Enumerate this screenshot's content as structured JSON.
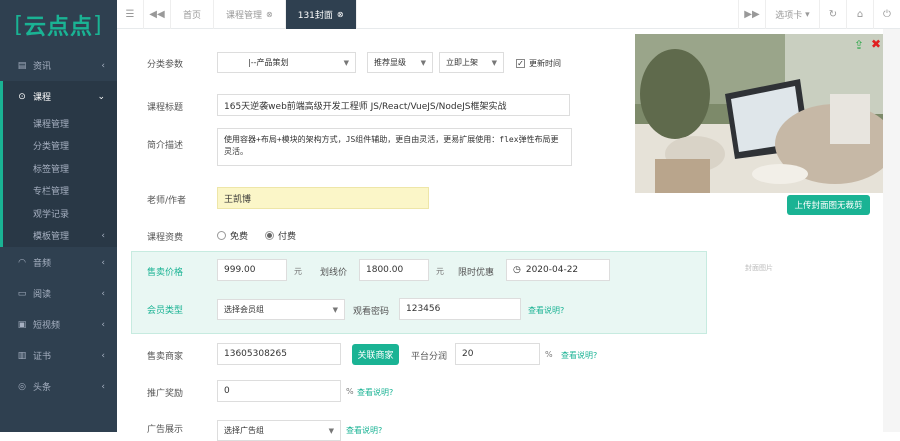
{
  "sidebar": {
    "logo": "云点点",
    "items": [
      {
        "label": "资讯",
        "icon": "news-icon"
      },
      {
        "label": "课程",
        "icon": "course-icon",
        "active": true
      },
      {
        "label": "音频",
        "icon": "headphones-icon"
      },
      {
        "label": "阅读",
        "icon": "book-icon"
      },
      {
        "label": "短视频",
        "icon": "video-icon"
      },
      {
        "label": "证书",
        "icon": "certificate-icon"
      },
      {
        "label": "头条",
        "icon": "compass-icon"
      }
    ],
    "course_sub": [
      "课程管理",
      "分类管理",
      "标签管理",
      "专栏管理",
      "观学记录",
      "模板管理"
    ]
  },
  "topbar": {
    "tabs": [
      {
        "label": "首页"
      },
      {
        "label": "课程管理"
      },
      {
        "label": "131封面",
        "active": true
      }
    ],
    "options_label": "选项卡"
  },
  "form": {
    "category_label": "分类参数",
    "category_value": "|--产品策划",
    "recommend_value": "推荐显级",
    "publish_value": "立即上架",
    "update_time_label": "更新时间",
    "title_label": "课程标题",
    "title_value": "165天逆袭web前端高级开发工程师 JS/React/VueJS/NodeJS框架实战",
    "desc_label": "简介描述",
    "desc_value": "使用容器+布局+模块的架构方式，JS组件辅助，更自由灵活，更易扩展使用：flex弹性布局更灵活。",
    "teacher_label": "老师/作者",
    "teacher_value": "王凯博",
    "fee_label": "课程资费",
    "fee_free": "免费",
    "fee_paid": "付费",
    "price_label": "售卖价格",
    "price_value": "999.00",
    "yuan1": "元",
    "line_price_label": "划线价",
    "line_price_value": "1800.00",
    "yuan2": "元",
    "limit_label": "限时优惠",
    "limit_date": "2020-04-22",
    "member_label": "会员类型",
    "member_value": "选择会员组",
    "watch_pwd_label": "观看密码",
    "watch_pwd_value": "123456",
    "see_desc1": "查看说明?",
    "merchant_label": "售卖商家",
    "merchant_value": "13605308265",
    "link_merchant_btn": "关联商家",
    "platform_label": "平台分润",
    "platform_value": "20",
    "pct1": "%",
    "see_desc2": "查看说明?",
    "promo_label": "推广奖励",
    "promo_value": "0",
    "pct2": "%",
    "see_desc3": "查看说明?",
    "ad_label": "广告展示",
    "ad_value": "选择广告组",
    "see_desc4": "查看说明?"
  },
  "cover": {
    "upload_btn": "上传封面图无裁剪",
    "label": "封面图片"
  },
  "colors": {
    "accent": "#1ab394",
    "sidebar": "#2f4050"
  }
}
